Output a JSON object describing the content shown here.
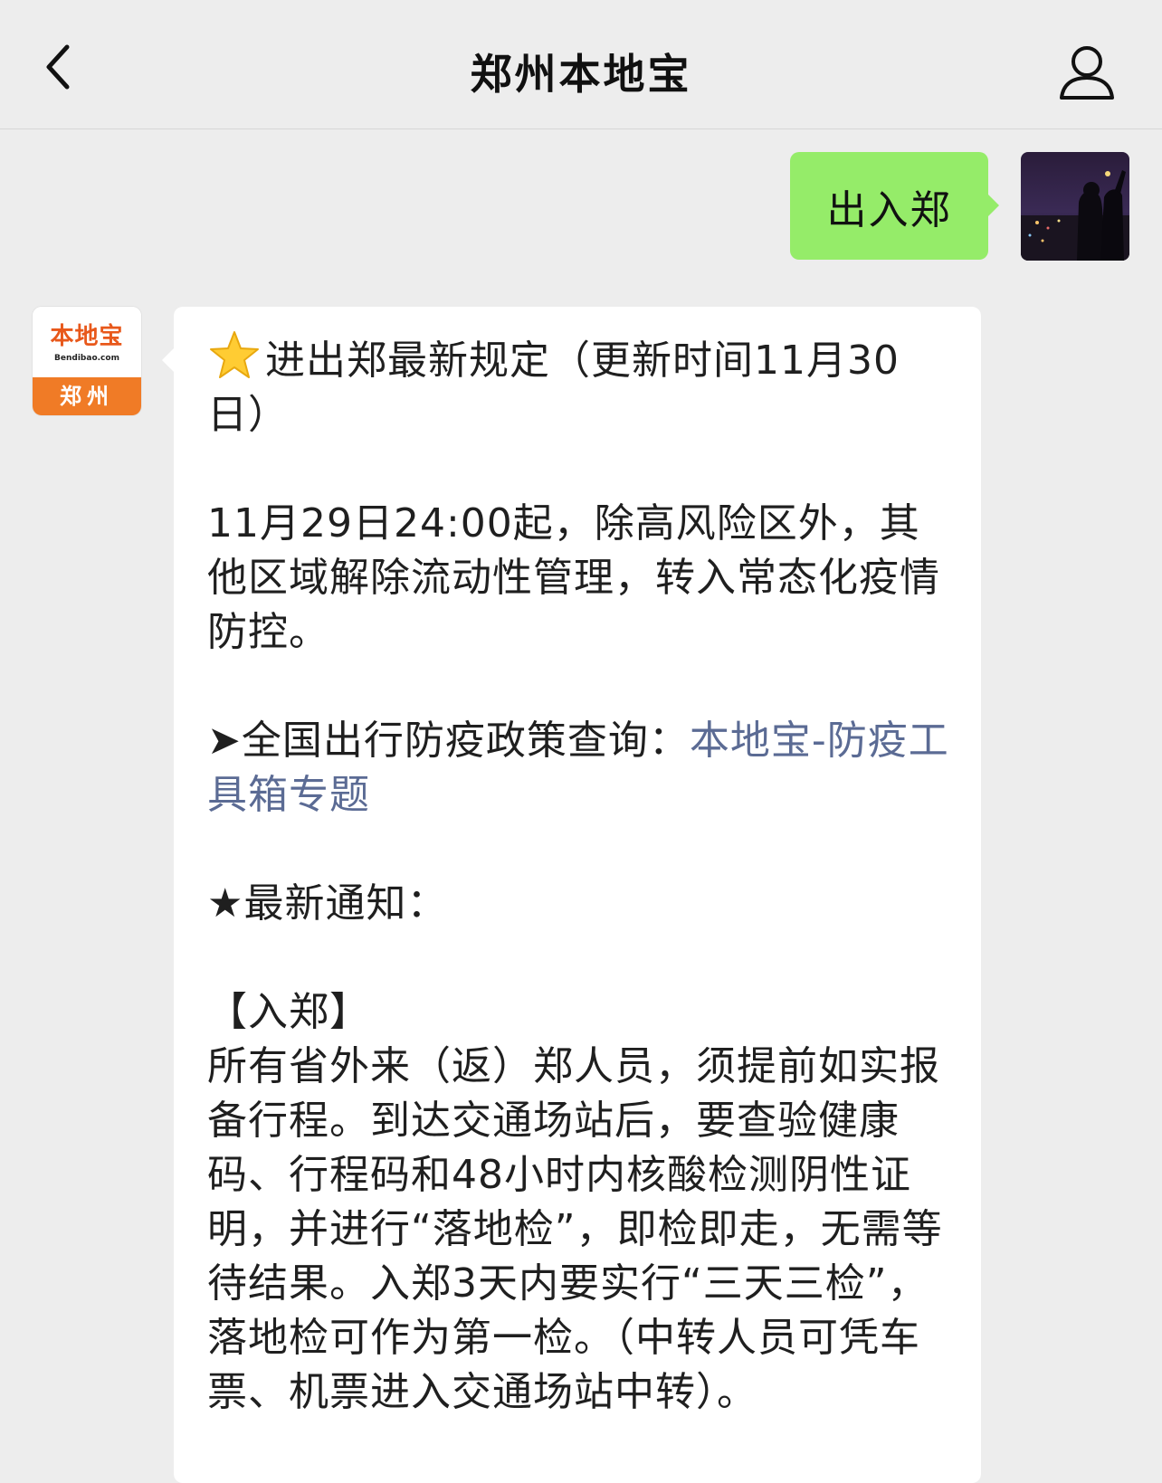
{
  "header": {
    "title": "郑州本地宝",
    "back_icon": "chevron-left-icon",
    "profile_icon": "user-icon"
  },
  "messages": {
    "user": {
      "text": "出入郑",
      "bubble_color": "#95ec69"
    },
    "bot": {
      "avatar": {
        "logo_text": "本地宝",
        "logo_url": "Bendibao.com",
        "logo_city": "郑州",
        "brand_color": "#f07b26"
      },
      "title": "进出郑最新规定（更新时间11月30日）",
      "p1": "11月29日24:00起，除高风险区外，其他区域解除流动性管理，转入常态化疫情防控。",
      "p2_prefix": "➤全国出行防疫政策查询：",
      "p2_link": "本地宝-防疫工具箱专题",
      "p3": "★最新通知：",
      "p4_heading": "【入郑】",
      "p4_body": "所有省外来（返）郑人员，须提前如实报备行程。到达交通场站后，要查验健康码、行程码和48小时内核酸检测阴性证明，并进行“落地检”，即检即走，无需等待结果。入郑3天内要实行“三天三检”，落地检可作为第一检。（中转人员可凭车票、机票进入交通场站中转）。",
      "link_color": "#5b6b94"
    }
  }
}
